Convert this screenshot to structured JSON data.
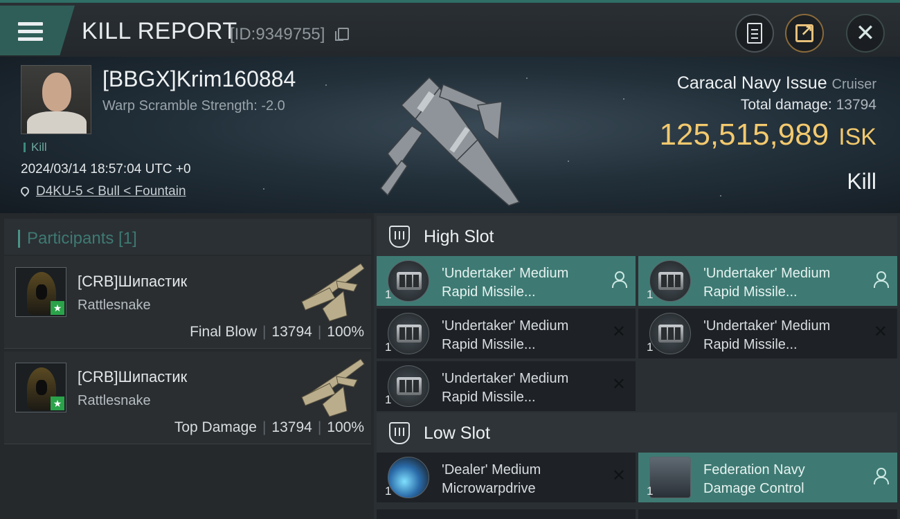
{
  "header": {
    "title": "KILL REPORT",
    "report_id": "[ID:9349755]",
    "buttons": {
      "menu": "menu-icon",
      "clipboard": "clipboard-icon",
      "share": "share-icon",
      "close": "close-icon"
    }
  },
  "victim": {
    "name": "[BBGX]Krim160884",
    "warp_scramble": "Warp Scramble Strength: -2.0",
    "tag": "Kill",
    "datetime": "2024/03/14 18:57:04 UTC +0",
    "location": "D4KU-5 < Bull < Fountain",
    "ship_name": "Caracal Navy Issue",
    "ship_class": "Cruiser",
    "total_damage_label": "Total damage:",
    "total_damage_value": "13794",
    "isk_value": "125,515,989",
    "isk_unit": "ISK",
    "result": "Kill"
  },
  "participants": {
    "title": "Participants [1]",
    "rows": [
      {
        "name": "[CRB]Шипастик",
        "ship": "Rattlesnake",
        "role": "Final Blow",
        "damage": "13794",
        "percent": "100%"
      },
      {
        "name": "[CRB]Шипастик",
        "ship": "Rattlesnake",
        "role": "Top Damage",
        "damage": "13794",
        "percent": "100%"
      }
    ]
  },
  "fittings": {
    "high_slot_label": "High Slot",
    "low_slot_label": "Low Slot",
    "high_slots": [
      {
        "line1": "'Undertaker' Medium",
        "line2": "Rapid Missile...",
        "qty": "1",
        "status": "dropped"
      },
      {
        "line1": "'Undertaker' Medium",
        "line2": "Rapid Missile...",
        "qty": "1",
        "status": "dropped"
      },
      {
        "line1": "'Undertaker' Medium",
        "line2": "Rapid Missile...",
        "qty": "1",
        "status": "destroyed"
      },
      {
        "line1": "'Undertaker' Medium",
        "line2": "Rapid Missile...",
        "qty": "1",
        "status": "destroyed"
      },
      {
        "line1": "'Undertaker' Medium",
        "line2": "Rapid Missile...",
        "qty": "1",
        "status": "destroyed"
      }
    ],
    "low_slots": [
      {
        "line1": "'Dealer' Medium",
        "line2": "Microwarpdrive",
        "qty": "1",
        "status": "destroyed"
      },
      {
        "line1": "Federation Navy",
        "line2": "Damage Control",
        "qty": "1",
        "status": "dropped"
      }
    ]
  },
  "colors": {
    "accent_teal": "#3e7a73",
    "isk_gold": "#f3c96e",
    "background": "#1a1d20"
  }
}
